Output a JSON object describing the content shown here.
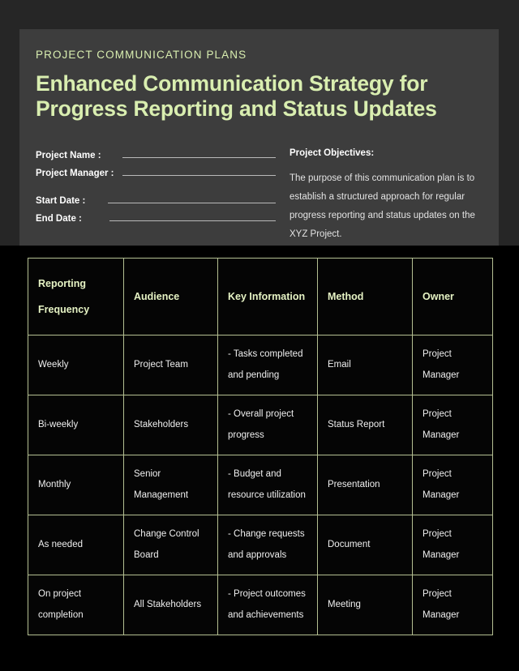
{
  "document": {
    "eyebrow": "PROJECT COMMUNICATION PLANS",
    "headline": "Enhanced Communication Strategy for Progress Reporting and Status Updates",
    "accent_color": "#d9eeb0",
    "panel_color": "#3d3d3d",
    "page_color": "#000000",
    "band_color": "#262626",
    "table_border_color": "#b4bf92"
  },
  "form": {
    "fields": [
      {
        "label": "Project Name :",
        "value": ""
      },
      {
        "label": "Project Manager :",
        "value": ""
      },
      {
        "label": "Start Date :",
        "value": ""
      },
      {
        "label": "End Date :",
        "value": ""
      }
    ]
  },
  "objectives": {
    "title": "Project Objectives:",
    "body": "The purpose of this communication plan is to establish a structured approach for regular progress reporting and status updates on the XYZ Project."
  },
  "table": {
    "headers": [
      "Reporting Frequency",
      "Audience",
      "Key Information",
      "Method",
      "Owner"
    ],
    "header_parts": {
      "frequency_line1": "Reporting",
      "frequency_line2": "Frequency"
    },
    "rows": [
      {
        "frequency_line1": "Weekly",
        "frequency_line2": "",
        "audience_line1": "Project Team",
        "audience_line2": "",
        "key_line1": "- Tasks completed",
        "key_line2": "and pending",
        "method": "Email",
        "owner": "Project Manager"
      },
      {
        "frequency_line1": "Bi-weekly",
        "frequency_line2": "",
        "audience_line1": "Stakeholders",
        "audience_line2": "",
        "key_line1": "- Overall project",
        "key_line2": "progress",
        "method": "Status Report",
        "owner": "Project Manager"
      },
      {
        "frequency_line1": "Monthly",
        "frequency_line2": "",
        "audience_line1": "Senior",
        "audience_line2": "Management",
        "key_line1": "- Budget and",
        "key_line2": "resource utilization",
        "method": "Presentation",
        "owner": "Project Manager"
      },
      {
        "frequency_line1": "As needed",
        "frequency_line2": "",
        "audience_line1": "Change Control",
        "audience_line2": "Board",
        "key_line1": "- Change requests",
        "key_line2": "and approvals",
        "method": "Document",
        "owner": "Project Manager"
      },
      {
        "frequency_line1": "On project",
        "frequency_line2": "completion",
        "audience_line1": "All Stakeholders",
        "audience_line2": "",
        "key_line1": "- Project outcomes",
        "key_line2": "and achievements",
        "method": "Meeting",
        "owner": "Project Manager"
      }
    ]
  }
}
